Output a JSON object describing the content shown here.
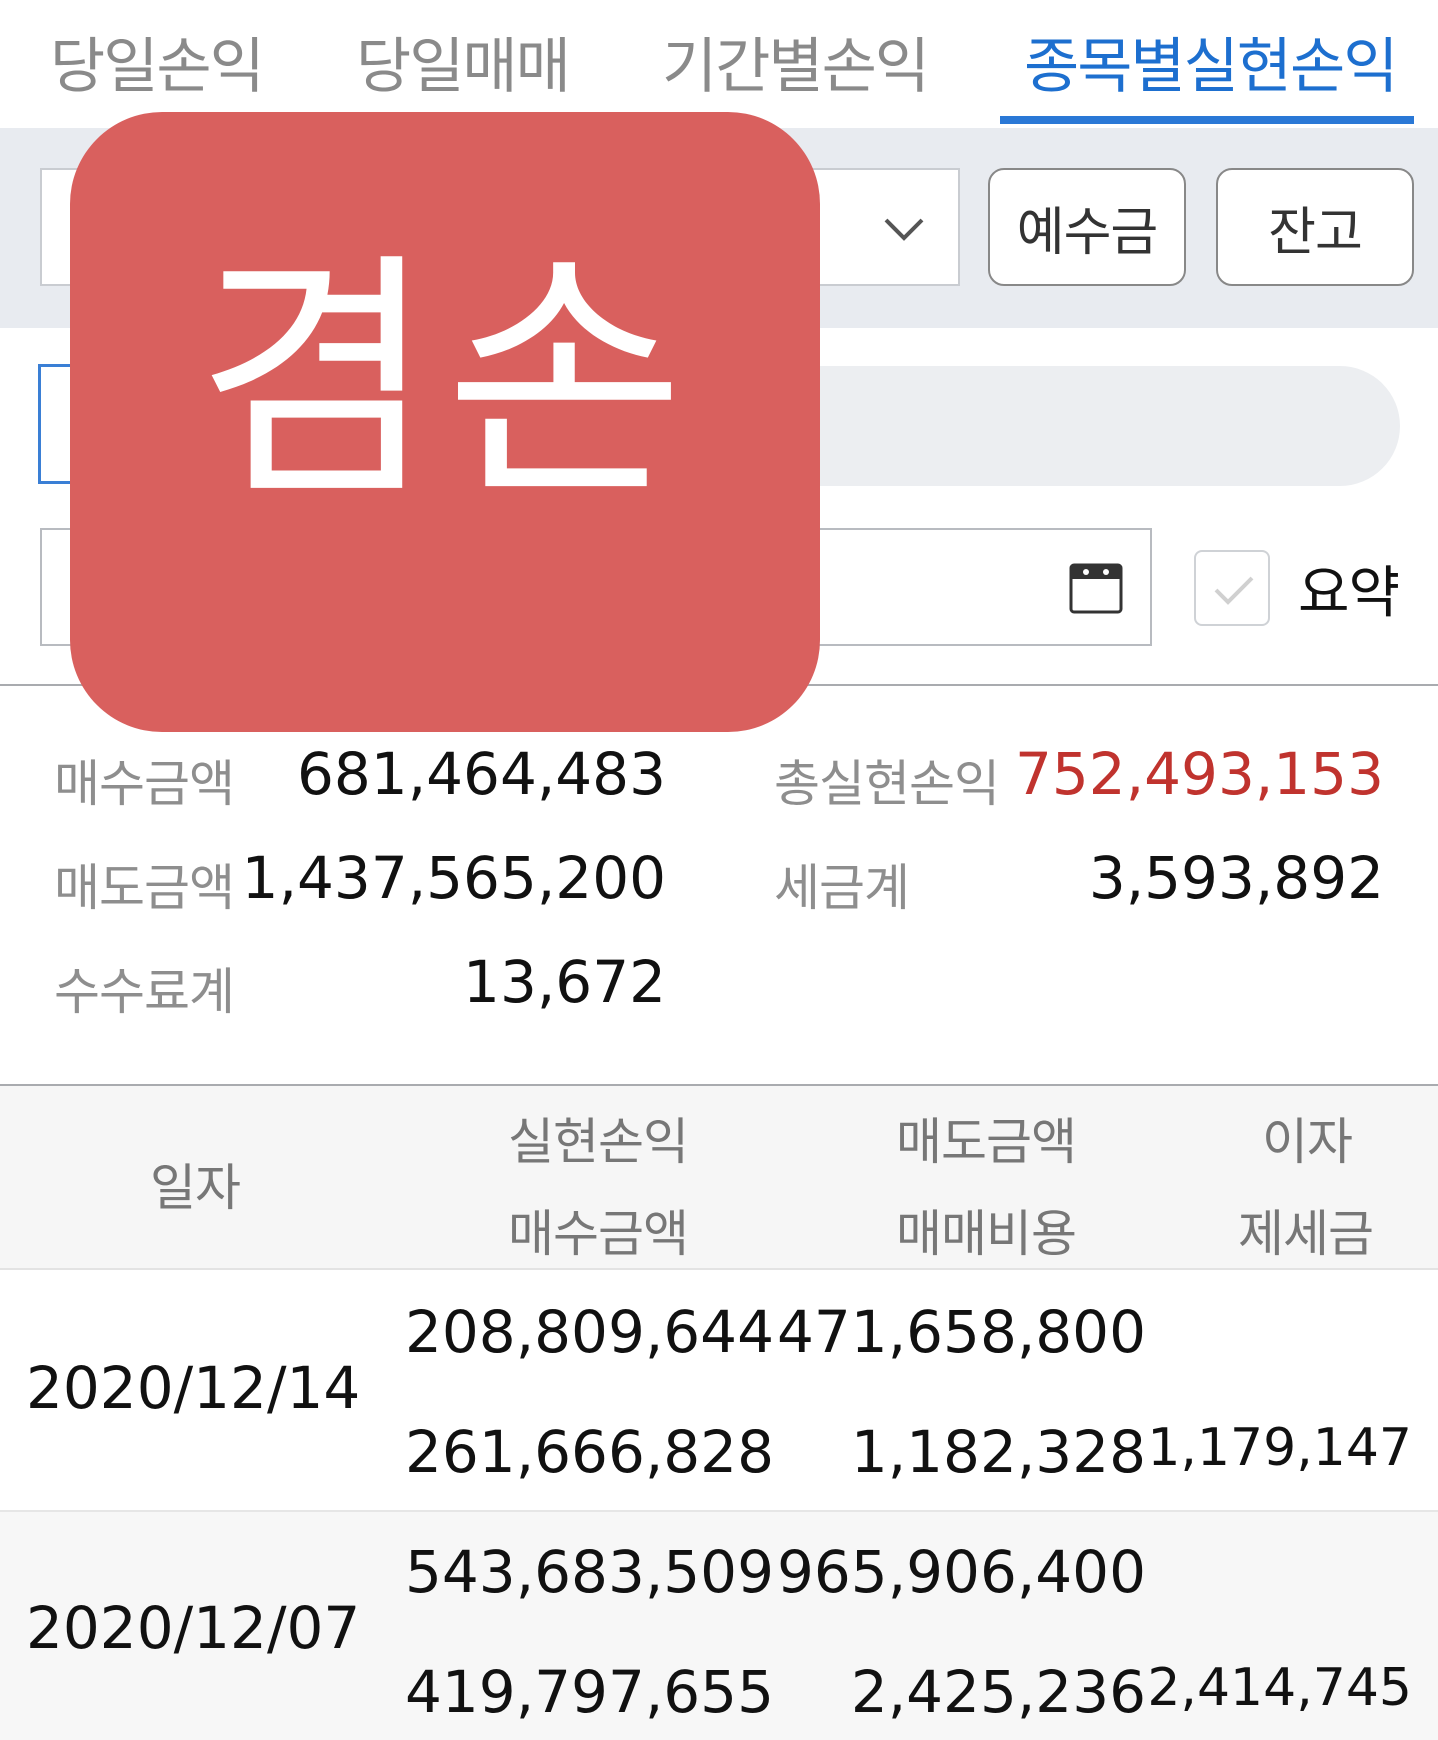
{
  "tabs": [
    {
      "label": "당일손익",
      "active": false
    },
    {
      "label": "당일매매",
      "active": false
    },
    {
      "label": "기간별손익",
      "active": false
    },
    {
      "label": "종목별실현손익",
      "active": true
    }
  ],
  "buttons": {
    "deposit": "예수금",
    "balance": "잔고"
  },
  "summary_checkbox": {
    "label": "요약",
    "checked": true
  },
  "summary": {
    "buy_amount_label": "매수금액",
    "buy_amount": "681,464,483",
    "sell_amount_label": "매도금액",
    "sell_amount": "1,437,565,200",
    "fee_total_label": "수수료계",
    "fee_total": "13,672",
    "total_realized_label": "총실현손익",
    "total_realized": "752,493,153",
    "tax_total_label": "세금계",
    "tax_total": "3,593,892"
  },
  "table": {
    "headers": {
      "date": "일자",
      "realized": "실현손익",
      "buy": "매수금액",
      "sell": "매도금액",
      "cost": "매매비용",
      "interest": "이자",
      "tax": "제세금"
    },
    "rows": [
      {
        "date": "2020/12/14",
        "realized": "208,809,644",
        "sell": "471,658,800",
        "interest": "",
        "buy": "261,666,828",
        "cost": "1,182,328",
        "tax": "1,179,147"
      },
      {
        "date": "2020/12/07",
        "realized": "543,683,509",
        "sell": "965,906,400",
        "interest": "",
        "buy": "419,797,655",
        "cost": "2,425,236",
        "tax": "2,414,745"
      }
    ]
  },
  "overlay": {
    "text": "겸손",
    "color": "#d9605e"
  },
  "colors": {
    "accent": "#2a78d6",
    "profit": "#c0332e"
  }
}
